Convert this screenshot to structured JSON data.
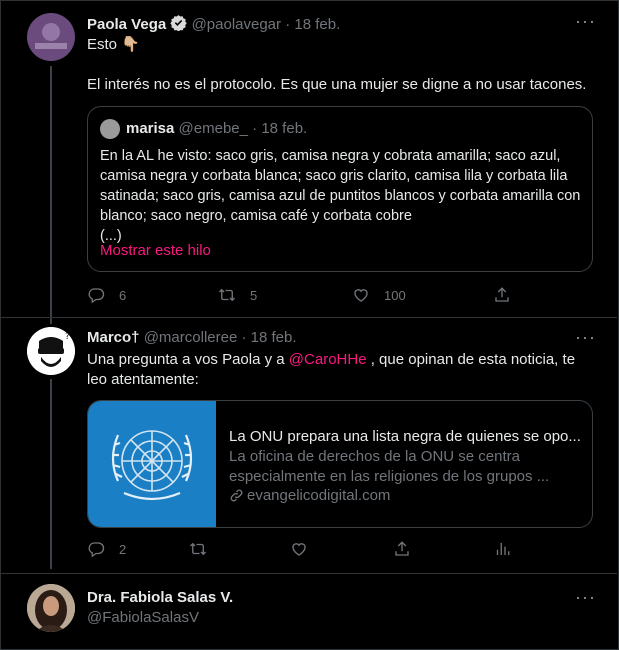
{
  "tweet1": {
    "name": "Paola Vega",
    "handle": "@paolavegar",
    "sep": "·",
    "date": "18 feb.",
    "line1": "Esto",
    "line1_emoji": "👇🏼",
    "line2": "El interés no es el protocolo. Es que una mujer se digne a no usar tacones.",
    "quote": {
      "name": "marisa",
      "handle": "@emebe_",
      "sep": "·",
      "date": "18 feb.",
      "text": "En la AL he visto: saco gris, camisa negra y cobrata amarilla; saco azul, camisa negra y corbata blanca; saco gris clarito, camisa lila y corbata lila satinada; saco gris, camisa azul de puntitos blancos y corbata amarilla con blanco; saco negro, camisa café y corbata cobre",
      "ellipsis": "(...)",
      "show_thread": "Mostrar este hilo"
    },
    "actions": {
      "replies": "6",
      "retweets": "5",
      "likes": "100"
    }
  },
  "tweet2": {
    "name": "Marco†",
    "handle": "@marcolleree",
    "sep": "·",
    "date": "18 feb.",
    "text_before": "Una pregunta a vos Paola y a ",
    "mention": "@CaroHHe",
    "text_after": " , que opinan de esta noticia, te leo atentamente:",
    "card": {
      "title": "La ONU prepara una lista negra de quienes se opo...",
      "description": "La oficina de derechos de la ONU se centra especialmente en las religiones de los grupos ...",
      "domain": "evangelicodigital.com",
      "image_color": "#1a7fc4"
    },
    "actions": {
      "replies": "2"
    }
  },
  "tweet3": {
    "name": "Dra. Fabiola Salas V.",
    "handle": "@FabiolaSalasV"
  },
  "colors": {
    "accent": "#f91880",
    "link_card_blue": "#1a7fc4",
    "muted": "#71767b"
  },
  "icons": [
    "verified-badge-icon",
    "more-icon",
    "reply-icon",
    "retweet-icon",
    "like-icon",
    "share-icon",
    "analytics-icon",
    "link-icon",
    "un-emblem-icon"
  ]
}
